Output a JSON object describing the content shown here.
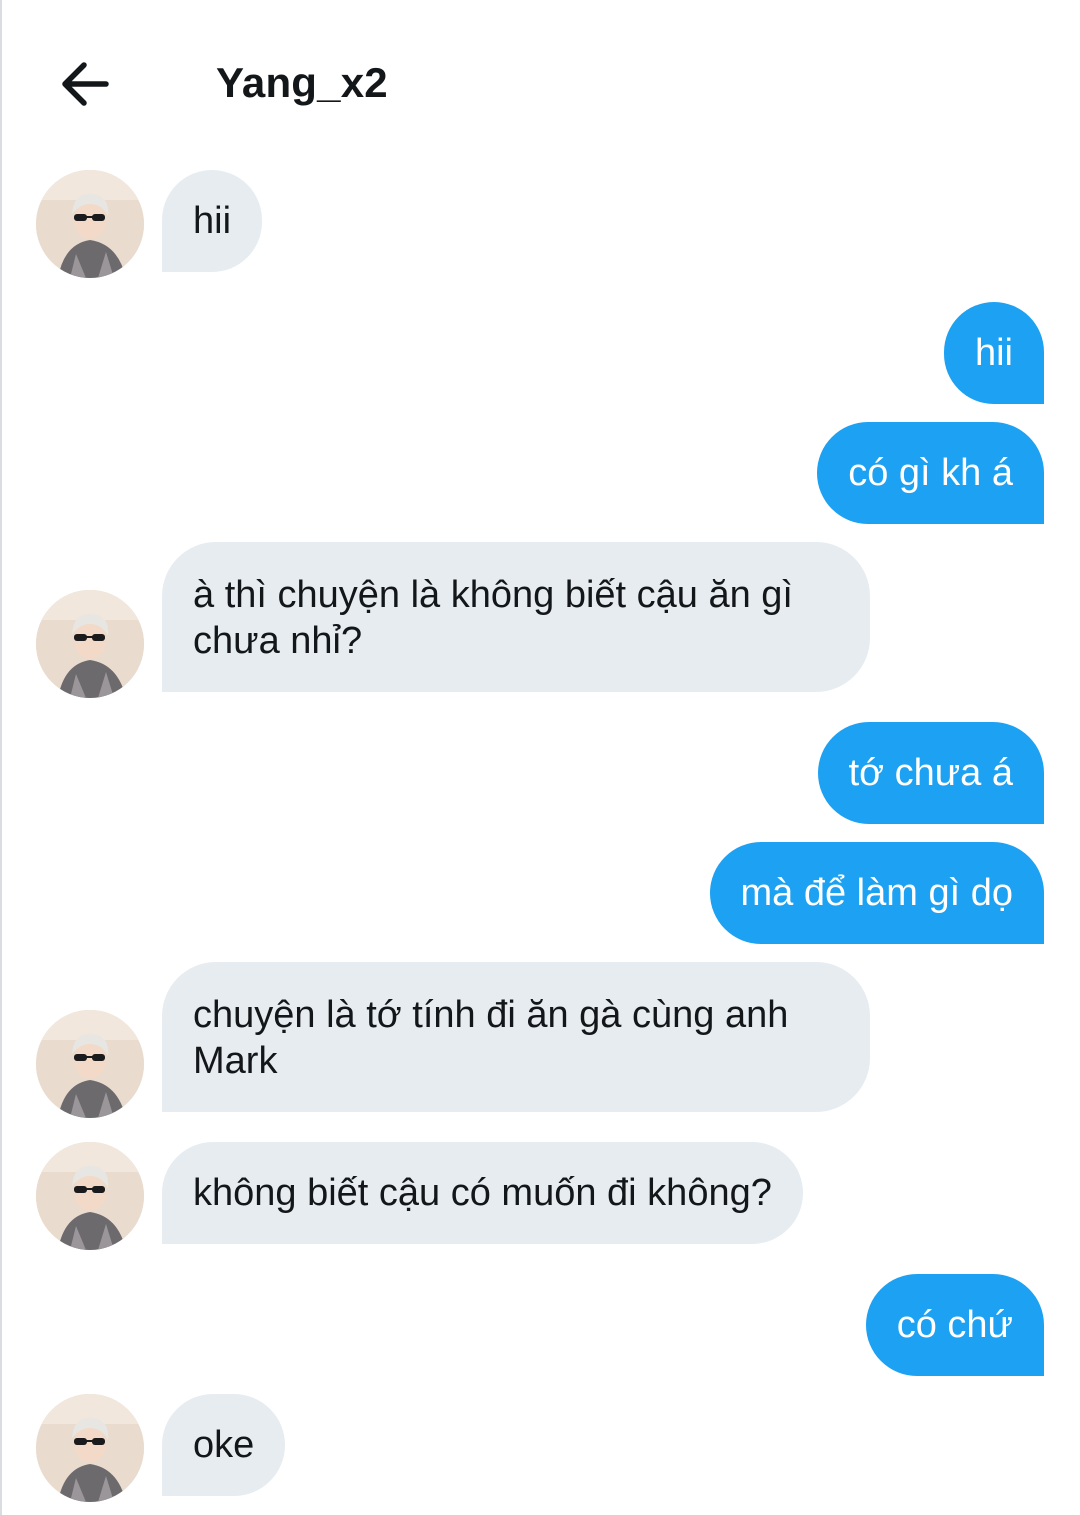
{
  "header": {
    "back_icon": "arrow-left-icon",
    "title": "Yang_x2"
  },
  "colors": {
    "incoming_bubble": "#e6ecf0",
    "outgoing_bubble": "#1da1f2",
    "outgoing_text": "#ffffff",
    "text": "#14171a"
  },
  "messages": [
    {
      "from": "them",
      "text": "hii"
    },
    {
      "from": "me",
      "text": "hii"
    },
    {
      "from": "me",
      "text": "có gì kh á"
    },
    {
      "from": "them",
      "text": "à thì chuyện là không biết cậu ăn gì chưa nhỉ?"
    },
    {
      "from": "me",
      "text": "tớ chưa á"
    },
    {
      "from": "me",
      "text": "mà để làm gì dọ"
    },
    {
      "from": "them",
      "text": "chuyện là tớ tính đi ăn gà cùng anh Mark"
    },
    {
      "from": "them",
      "text": "không biết cậu có muốn đi không?"
    },
    {
      "from": "me",
      "text": "có chứ"
    },
    {
      "from": "them",
      "text": "oke"
    }
  ]
}
